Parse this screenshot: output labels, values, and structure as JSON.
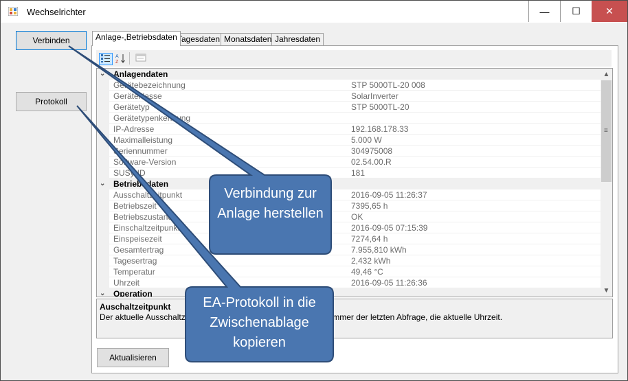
{
  "window": {
    "title": "Wechselrichter",
    "minimize_symbol": "—",
    "maximize_symbol": "☐",
    "close_symbol": "✕"
  },
  "buttons": {
    "connect": "Verbinden",
    "protocol": "Protokoll",
    "update": "Aktualisieren"
  },
  "tabs": [
    {
      "label": "Anlage-,Betriebsdaten",
      "active": true
    },
    {
      "label": "Tagesdaten",
      "active": false
    },
    {
      "label": "Monatsdaten",
      "active": false
    },
    {
      "label": "Jahresdaten",
      "active": false
    }
  ],
  "toolbar": {
    "categorized_icon": "categorized-view-icon",
    "alphabetical_icon": "alphabetical-sort-icon",
    "property_pages_icon": "property-pages-icon"
  },
  "property_grid": {
    "categories": [
      {
        "name": "Anlagendaten",
        "rows": [
          {
            "name": "Gerätebezeichnung",
            "value": "STP 5000TL-20 008"
          },
          {
            "name": "Geräteklasse",
            "value": "SolarInverter"
          },
          {
            "name": "Gerätetyp",
            "value": "STP 5000TL-20"
          },
          {
            "name": "Gerätetypenkennung",
            "value": ""
          },
          {
            "name": "IP-Adresse",
            "value": "192.168.178.33"
          },
          {
            "name": "Maximalleistung",
            "value": "5.000 W"
          },
          {
            "name": "Seriennummer",
            "value": "304975008"
          },
          {
            "name": "Software-Version",
            "value": "02.54.00.R"
          },
          {
            "name": "SUSy-ID",
            "value": "181"
          }
        ]
      },
      {
        "name": "Betriebsdaten",
        "rows": [
          {
            "name": "Ausschaltzeitpunkt",
            "value": "2016-09-05 11:26:37"
          },
          {
            "name": "Betriebszeit",
            "value": "7395,65 h"
          },
          {
            "name": "Betriebszustand",
            "value": "OK"
          },
          {
            "name": "Einschaltzeitpunkt",
            "value": "2016-09-05 07:15:39"
          },
          {
            "name": "Einspeisezeit",
            "value": "7274,64 h"
          },
          {
            "name": "Gesamtertrag",
            "value": "7.955,810 kWh"
          },
          {
            "name": "Tagesertrag",
            "value": "2,432 kWh"
          },
          {
            "name": "Temperatur",
            "value": "49,46 °C"
          },
          {
            "name": "Uhrzeit",
            "value": "2016-09-05 11:26:36"
          }
        ]
      },
      {
        "name": "Operation",
        "rows": []
      }
    ],
    "help": {
      "title": "Auschaltzeitpunkt",
      "description": "Der aktuelle Ausschaltzeitpunkt des Wechselrichters entspricht immer der letzten Abfrage, die aktuelle Uhrzeit."
    }
  },
  "callouts": [
    {
      "text": "Verbindung zur Anlage herstellen"
    },
    {
      "text": "EA-Protokoll in die Zwischenablage kopieren"
    }
  ],
  "colors": {
    "callout_fill": "#4a76b0",
    "callout_border": "#2e4d78",
    "window_background": "#f0f0f0",
    "close_button": "#c75050"
  }
}
